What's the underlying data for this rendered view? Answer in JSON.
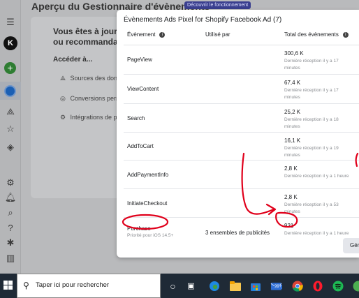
{
  "background": {
    "page_title": "Aperçu du Gestionnaire d'évènements",
    "discover_label": "Découvrir le fonctionnement",
    "heading_line1": "Vous êtes à jour. Il",
    "heading_line2": "ou recommandatio",
    "access_label": "Accéder à...",
    "links": [
      "Sources des donn",
      "Conversions pers",
      "Intégrations de pa"
    ]
  },
  "modal": {
    "title": "Évènements Ads Pixel for Shopify Facebook Ad (7)",
    "columns": {
      "event": "Évènement",
      "used_by": "Utilisé par",
      "total": "Total des évènements"
    },
    "rows": [
      {
        "name": "PageView",
        "sub": "",
        "used_by": "",
        "total": "300,6 K",
        "received": "Dernière réception il y a 17 minutes"
      },
      {
        "name": "ViewContent",
        "sub": "",
        "used_by": "",
        "total": "67,4 K",
        "received": "Dernière réception il y a 17 minutes"
      },
      {
        "name": "Search",
        "sub": "",
        "used_by": "",
        "total": "25,2 K",
        "received": "Dernière réception il y a 18 minutes"
      },
      {
        "name": "AddToCart",
        "sub": "",
        "used_by": "",
        "total": "16,1 K",
        "received": "Dernière réception il y a 19 minutes"
      },
      {
        "name": "AddPaymentInfo",
        "sub": "",
        "used_by": "",
        "total": "2,8 K",
        "received": "Dernière réception il y a 1 heure"
      },
      {
        "name": "InitiateCheckout",
        "sub": "",
        "used_by": "",
        "total": "2,8 K",
        "received": "Dernière réception il y a 53 minutes"
      },
      {
        "name": "Purchase",
        "sub": "Priorité pour iOS 14.5+",
        "used_by": "3 ensembles de publicités",
        "total": "931",
        "received": "Dernière réception il y a 1 heure"
      }
    ],
    "button_label": "Gén"
  },
  "taskbar": {
    "search_placeholder": "Taper ici pour rechercher",
    "mail_badge": "99+"
  },
  "colors": {
    "annotation": "#e0001b",
    "taskbar": "#1f2a36",
    "modal_bg": "#ffffff"
  }
}
